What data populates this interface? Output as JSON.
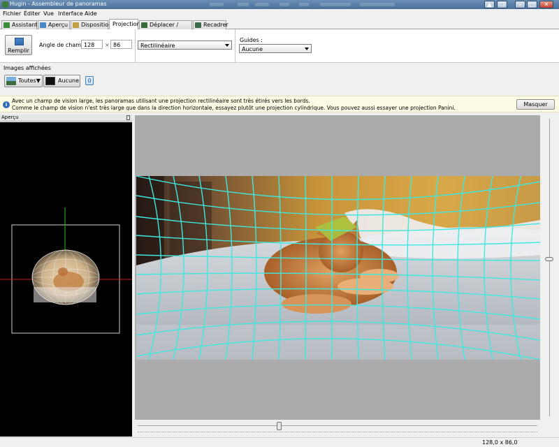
{
  "window": {
    "title": "Hugin - Assembleur de panoramas"
  },
  "menu": [
    "Fichier",
    "Éditer",
    "Vue",
    "Interface",
    "Aide"
  ],
  "tabs": [
    {
      "label": "Assistant",
      "icon": "wand-icon",
      "color": "#3a8a3a"
    },
    {
      "label": "Aperçu",
      "icon": "image-icon",
      "color": "#4a88c8"
    },
    {
      "label": "Disposition",
      "icon": "layout-icon",
      "color": "#c0a040"
    },
    {
      "label": "Projection",
      "active": true
    },
    {
      "label": "Déplacer / Glisser",
      "icon": "move-icon",
      "color": "#3a6a3a"
    },
    {
      "label": "Recadrer",
      "icon": "crop-icon",
      "color": "#3a6a4a"
    }
  ],
  "toolbar": {
    "fill_label": "Remplir",
    "fov_label": "Angle de champ :",
    "fov_h": "128",
    "fov_x": "×",
    "fov_v": "86",
    "projection": "Rectilinéaire",
    "guides_label": "Guides :",
    "guides_value": "Aucune"
  },
  "images": {
    "label": "Images affichées",
    "all_label": "Toutes▼",
    "none_label": "Aucune",
    "count": "0"
  },
  "info": {
    "line1": "Avec un champ de vision large, les panoramas utilisant une projection rectilinéaire sont très étirés vers les bords.",
    "line2": "Comme le champ de vision n'est très large que dans la direction horizontale, essayez plutôt une projection cylindrique. Vous pouvez aussi essayer une projection Panini.",
    "hide_label": "Masquer"
  },
  "overview": {
    "title": "Aperçu"
  },
  "status": {
    "fov": "128,0 x 86,0"
  },
  "colors": {
    "grid": "#3ee8e0",
    "axis_red": "#d02020",
    "axis_green": "#20c020"
  }
}
